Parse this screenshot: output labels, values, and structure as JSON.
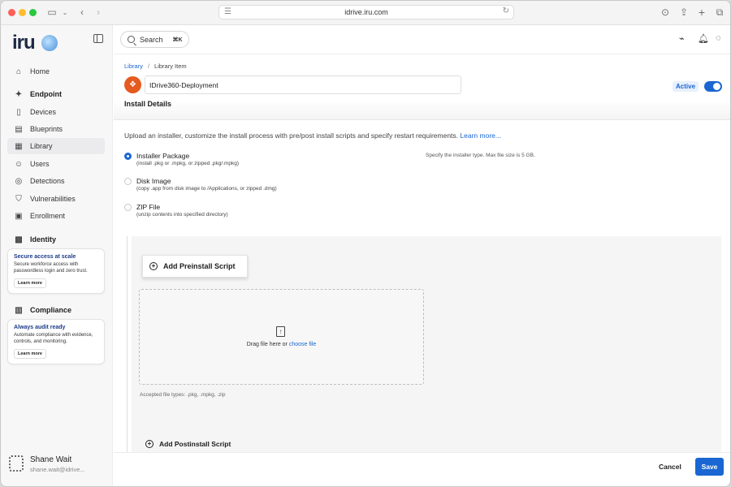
{
  "browser": {
    "url": "idrive.iru.com"
  },
  "sidebar": {
    "logo": "iru",
    "items": [
      {
        "label": "Home",
        "icon": "home-icon"
      },
      {
        "label": "Endpoint",
        "icon": "endpoint-icon"
      },
      {
        "label": "Devices",
        "icon": "devices-icon"
      },
      {
        "label": "Blueprints",
        "icon": "blueprints-icon"
      },
      {
        "label": "Library",
        "icon": "library-icon"
      },
      {
        "label": "Users",
        "icon": "users-icon"
      },
      {
        "label": "Detections",
        "icon": "detections-icon"
      },
      {
        "label": "Vulnerabilities",
        "icon": "shield-icon"
      },
      {
        "label": "Enrollment",
        "icon": "enrollment-icon"
      },
      {
        "label": "Identity",
        "icon": "identity-icon"
      },
      {
        "label": "Compliance",
        "icon": "compliance-icon"
      }
    ],
    "promo_identity": {
      "title": "Secure access at scale",
      "text": "Secure workforce access with passwordless login and zero trust.",
      "button": "Learn more"
    },
    "promo_compliance": {
      "title": "Always audit ready",
      "text": "Automate compliance with evidence, controls, and monitoring.",
      "button": "Learn more"
    },
    "user": {
      "name": "Shane Wait",
      "email": "shane.wait@idrive..."
    }
  },
  "topbar": {
    "search_label": "Search",
    "search_shortcut": "⌘K"
  },
  "main": {
    "breadcrumb": {
      "root": "Library",
      "separator": "/",
      "current": "Library Item"
    },
    "item_name": "IDrive360-Deployment",
    "status": "Active",
    "section_title": "Install Details",
    "intro_text": "Upload an installer, customize the install process with pre/post install scripts and specify restart requirements.",
    "intro_link": "Learn more...",
    "installer_hint": "Specify the installer type. Max file size is 5 GB.",
    "installer_types": [
      {
        "label": "Installer Package",
        "sub": "(install .pkg or .mpkg, or zipped .pkg/.mpkg)",
        "checked": true
      },
      {
        "label": "Disk Image",
        "sub": "(copy .app from disk image to /Applications, or zipped .dmg)",
        "checked": false
      },
      {
        "label": "ZIP File",
        "sub": "(unzip contents into specified directory)",
        "checked": false
      }
    ],
    "preinstall_button": "Add Preinstall Script",
    "drop_text": "Drag file here or",
    "drop_link": "choose file",
    "accepted_types": "Accepted file types: .pkg, .mpkg, .zip",
    "postinstall_button": "Add Postinstall Script"
  },
  "footer": {
    "cancel": "Cancel",
    "save": "Save"
  },
  "colors": {
    "accent": "#1a66d2",
    "item_icon": "#e55a1f"
  }
}
